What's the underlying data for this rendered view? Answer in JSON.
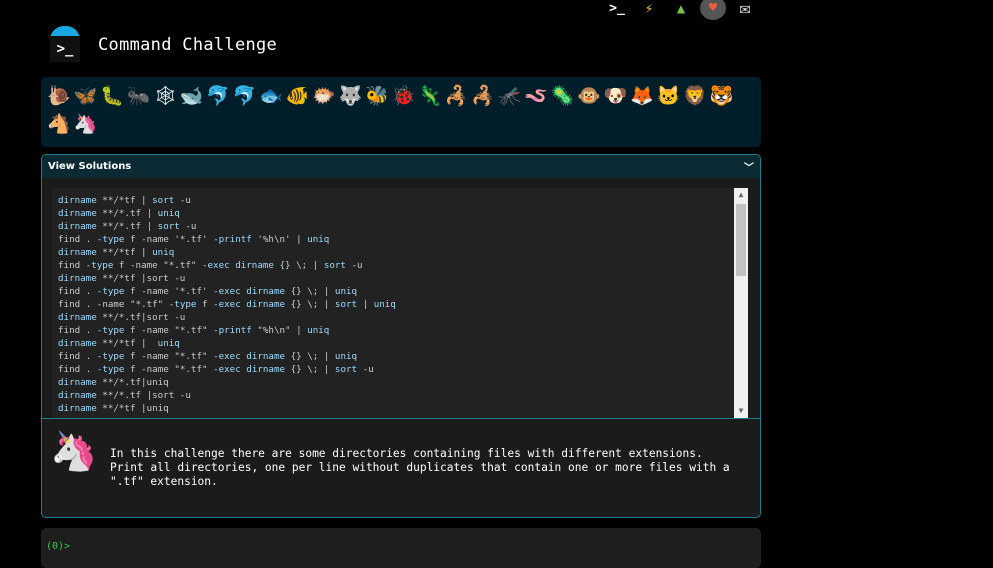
{
  "top_icons": [
    {
      "icon": "terminal-icon",
      "glyph": ">_"
    },
    {
      "icon": "lightning-icon",
      "glyph": "⚡"
    },
    {
      "icon": "tree-icon",
      "glyph": "▲"
    },
    {
      "icon": "heart-icon",
      "glyph": "♥"
    },
    {
      "icon": "mail-icon",
      "glyph": "✉"
    }
  ],
  "header": {
    "logo_glyph": ">_",
    "title": "Command Challenge"
  },
  "animals": [
    "🐌",
    "🦋",
    "🐛",
    "🐜",
    "🕸",
    "🐋",
    "🐬",
    "🐬",
    "🐟",
    "🐠",
    "🐡",
    "🐺",
    "🐝",
    "🐞",
    "🦎",
    "🦂",
    "🦂",
    "🦟",
    "🪱",
    "🦠",
    "🐵",
    "🐶",
    "🦊",
    "🐱",
    "🦁",
    "🐯",
    "🐴",
    "🦄"
  ],
  "solutions": {
    "header": "View Solutions",
    "lines": [
      "dirname **/*tf | sort -u",
      "dirname **/*.tf | uniq",
      "dirname **/*.tf | sort -u",
      "find . -type f -name '*.tf' -printf '%h\\n' | uniq",
      "dirname **/*tf | uniq",
      "find -type f -name \"*.tf\" -exec dirname {} \\; | sort -u",
      "dirname **/*tf |sort -u",
      "find . -type f -name '*.tf' -exec dirname {} \\; | uniq",
      "find . -name \"*.tf\" -type f -exec dirname {} \\; | sort | uniq",
      "dirname **/*.tf|sort -u",
      "find . -type f -name \"*.tf\" -printf \"%h\\n\" | uniq",
      "dirname **/*tf |  uniq",
      "find . -type f -name \"*.tf\" -exec dirname {} \\; | uniq",
      "find . -type f -name \"*.tf\" -exec dirname {} \\; | sort -u",
      "dirname **/*.tf|uniq",
      "dirname **/*.tf |sort -u",
      "dirname **/*tf |uniq"
    ]
  },
  "challenge": {
    "description": "In this challenge there are some directories containing files with different extensions.\nPrint all directories, one per line without duplicates that contain one or more files with a\n\".tf\" extension."
  },
  "terminal": {
    "prompt": "(0)>"
  }
}
